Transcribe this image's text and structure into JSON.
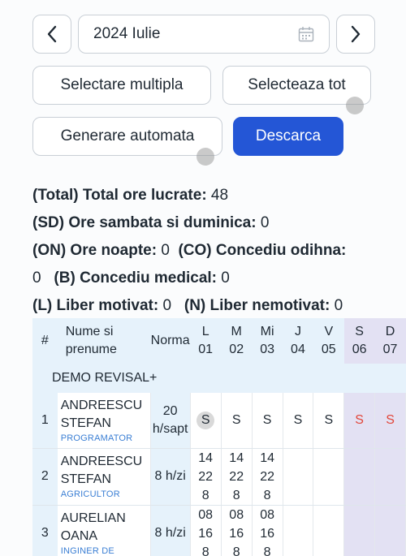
{
  "month": {
    "value": "2024 Iulie"
  },
  "buttons": {
    "multiple": "Selectare multipla",
    "all": "Selecteaza tot",
    "auto": "Generare automata",
    "download": "Descarca"
  },
  "stats": {
    "total_label": "(Total) Total ore lucrate:",
    "total_value": "48",
    "sd_label": "(SD) Ore sambata si duminica:",
    "sd_value": "0",
    "on_label": "(ON) Ore noapte:",
    "on_value": "0",
    "co_label": "(CO) Concediu odihna:",
    "co_value": "0",
    "b_label": "(B) Concediu medical:",
    "b_value": "0",
    "l_label": "(L) Liber motivat:",
    "l_value": "0",
    "n_label": "(N) Liber nemotivat:",
    "n_value": "0"
  },
  "table": {
    "headers": {
      "idx": "#",
      "name_l1": "Nume si",
      "name_l2": "prenume",
      "norma": "Norma",
      "days": [
        {
          "l1": "L",
          "l2": "01"
        },
        {
          "l1": "M",
          "l2": "02"
        },
        {
          "l1": "Mi",
          "l2": "03"
        },
        {
          "l1": "J",
          "l2": "04"
        },
        {
          "l1": "V",
          "l2": "05"
        },
        {
          "l1": "S",
          "l2": "06"
        },
        {
          "l1": "D",
          "l2": "07"
        }
      ]
    },
    "group": "DEMO REVISAL+",
    "rows": [
      {
        "idx": "1",
        "name_l1": "ANDREESCU",
        "name_l2": "STEFAN",
        "role": "PROGRAMATOR",
        "norma_l1": "20",
        "norma_l2": "h/sapt",
        "cells": [
          {
            "l1": "S",
            "l2": "",
            "l3": ""
          },
          {
            "l1": "S",
            "l2": "",
            "l3": ""
          },
          {
            "l1": "S",
            "l2": "",
            "l3": ""
          },
          {
            "l1": "S",
            "l2": "",
            "l3": ""
          },
          {
            "l1": "S",
            "l2": "",
            "l3": ""
          },
          {
            "l1": "S",
            "l2": "",
            "l3": ""
          },
          {
            "l1": "S",
            "l2": "",
            "l3": ""
          }
        ]
      },
      {
        "idx": "2",
        "name_l1": "ANDREESCU",
        "name_l2": "STEFAN",
        "role": "AGRICULTOR",
        "norma_l1": "8 h/zi",
        "norma_l2": "",
        "cells": [
          {
            "l1": "14",
            "l2": "22",
            "l3": "8"
          },
          {
            "l1": "14",
            "l2": "22",
            "l3": "8"
          },
          {
            "l1": "14",
            "l2": "22",
            "l3": "8"
          },
          {
            "l1": "",
            "l2": "",
            "l3": ""
          },
          {
            "l1": "",
            "l2": "",
            "l3": ""
          },
          {
            "l1": "",
            "l2": "",
            "l3": ""
          },
          {
            "l1": "",
            "l2": "",
            "l3": ""
          }
        ]
      },
      {
        "idx": "3",
        "name_l1": "AURELIAN",
        "name_l2": "OANA",
        "role": "INGINER DE",
        "norma_l1": "8 h/zi",
        "norma_l2": "",
        "cells": [
          {
            "l1": "08",
            "l2": "16",
            "l3": "8"
          },
          {
            "l1": "08",
            "l2": "16",
            "l3": "8"
          },
          {
            "l1": "08",
            "l2": "16",
            "l3": "8"
          },
          {
            "l1": "",
            "l2": "",
            "l3": ""
          },
          {
            "l1": "",
            "l2": "",
            "l3": ""
          },
          {
            "l1": "",
            "l2": "",
            "l3": ""
          },
          {
            "l1": "",
            "l2": "",
            "l3": ""
          }
        ]
      }
    ]
  },
  "colors": {
    "accent": "#2456d6",
    "weekend_text": "#e2463a",
    "header_bg": "#e6f2fb",
    "weekend_bg": "#e3e1f3"
  }
}
